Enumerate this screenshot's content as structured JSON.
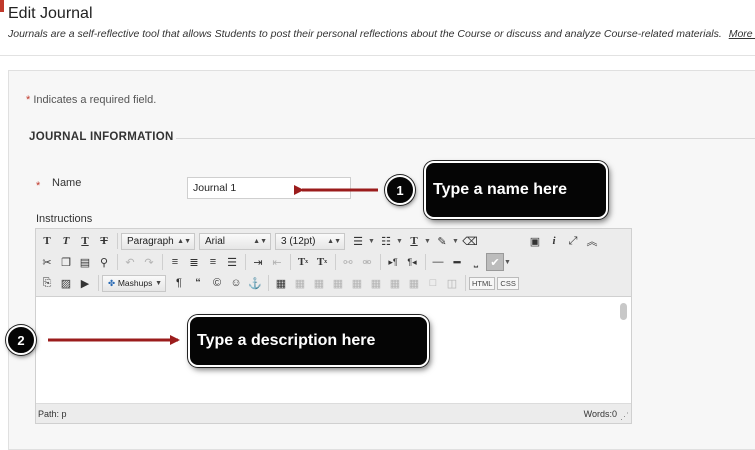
{
  "page": {
    "title": "Edit Journal",
    "description": "Journals are a self-reflective tool that allows Students to post their personal reflections about the Course or discuss and analyze Course-related materials.",
    "more_help": "More Help"
  },
  "form": {
    "required_star": "*",
    "required_note": "Indicates a required field.",
    "section_heading": "JOURNAL INFORMATION",
    "name_label": "Name",
    "name_value": "Journal 1",
    "instructions_label": "Instructions"
  },
  "toolbar": {
    "format_select": "Paragraph",
    "font_select": "Arial",
    "size_select": "3 (12pt)",
    "mashups_label": "Mashups",
    "html_label": "HTML",
    "css_label": "CSS",
    "icons": [
      "bold",
      "italic",
      "underline",
      "strikethrough",
      "paragraph-format",
      "font-family",
      "font-size",
      "bullet-list",
      "numbered-list",
      "text-color",
      "highlight",
      "clear-formatting",
      "preview",
      "info",
      "fullscreen",
      "collapse",
      "cut",
      "copy",
      "paste",
      "find",
      "undo",
      "redo",
      "align-left",
      "align-center",
      "align-right",
      "justify",
      "indent",
      "outdent",
      "superscript",
      "subscript",
      "link",
      "unlink",
      "ltr",
      "rtl",
      "horizontal-rule",
      "line",
      "nonbreaking-space",
      "spellcheck",
      "attach-file",
      "image",
      "media",
      "mashups",
      "pilcrow",
      "blockquote",
      "copyright",
      "emoticon",
      "anchor",
      "table",
      "table-row-before",
      "table-row-after",
      "table-delete-row",
      "table-col-before",
      "table-col-after",
      "table-delete-col",
      "table-cell-props",
      "table-merge",
      "table-split",
      "html-source",
      "css"
    ]
  },
  "statusbar": {
    "path": "Path: p",
    "words": "Words:0"
  },
  "callouts": {
    "step1_number": "1",
    "step1_text": "Type a name here",
    "step2_number": "2",
    "step2_text": "Type a description here"
  },
  "colors": {
    "required_star": "#c0392b",
    "arrow": "#9b1c1c",
    "callout_bg": "#050505"
  }
}
